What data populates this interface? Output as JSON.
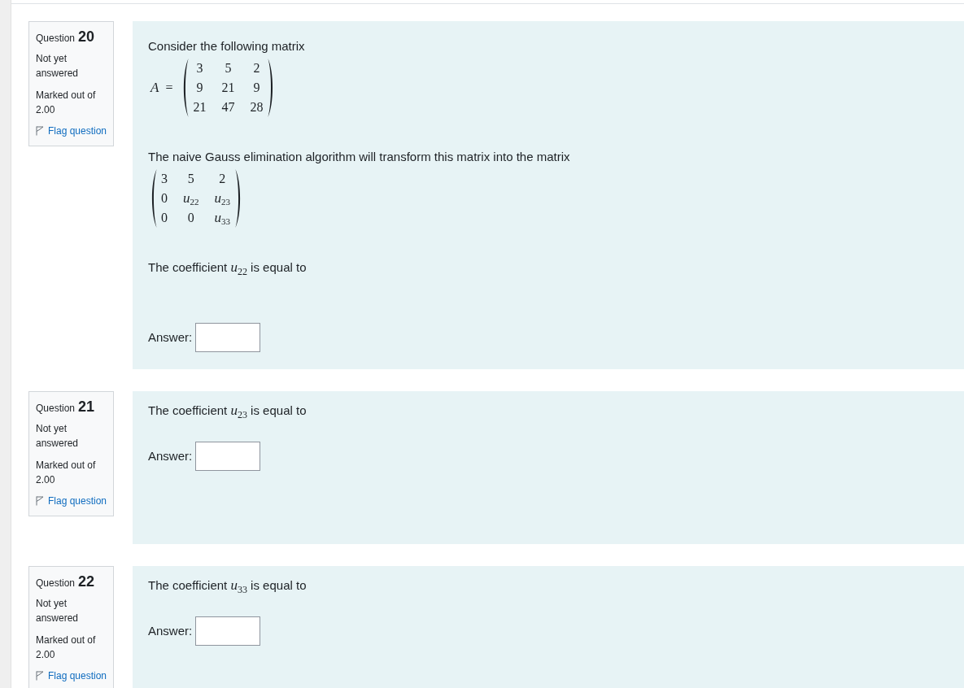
{
  "questions": [
    {
      "label": "Question",
      "number": "20",
      "status": "Not yet answered",
      "grade": "Marked out of 2.00",
      "flag": "Flag question",
      "blocks": [
        {
          "kind": "text",
          "text": "Consider the following matrix"
        },
        {
          "kind": "matrix",
          "lhs": "*A* =",
          "rows": [
            [
              "3",
              "5",
              "2"
            ],
            [
              "9",
              "21",
              "9"
            ],
            [
              "21",
              "47",
              "28"
            ]
          ]
        },
        {
          "kind": "text",
          "text": "The naive Gauss elimination algorithm will transform this matrix into the matrix"
        },
        {
          "kind": "matrix",
          "rows": [
            [
              "3",
              "5",
              "2"
            ],
            [
              "0",
              "*u*$_{22}$",
              "*u*$_{23}$"
            ],
            [
              "0",
              "0",
              "*u*$_{33}$"
            ]
          ]
        },
        {
          "kind": "text",
          "text": "The coefficient *u*$_{22}$ is equal to"
        },
        {
          "kind": "answer",
          "label": "Answer:"
        }
      ]
    },
    {
      "label": "Question",
      "number": "21",
      "status": "Not yet answered",
      "grade": "Marked out of 2.00",
      "flag": "Flag question",
      "blocks": [
        {
          "kind": "text",
          "text": "The coefficient *u*$_{23}$ is equal to"
        },
        {
          "kind": "answer",
          "label": "Answer:"
        }
      ]
    },
    {
      "label": "Question",
      "number": "22",
      "status": "Not yet answered",
      "grade": "Marked out of 2.00",
      "flag": "Flag question",
      "blocks": [
        {
          "kind": "text",
          "text": "The coefficient *u*$_{33}$ is equal to"
        },
        {
          "kind": "answer",
          "label": "Answer:"
        }
      ]
    }
  ]
}
